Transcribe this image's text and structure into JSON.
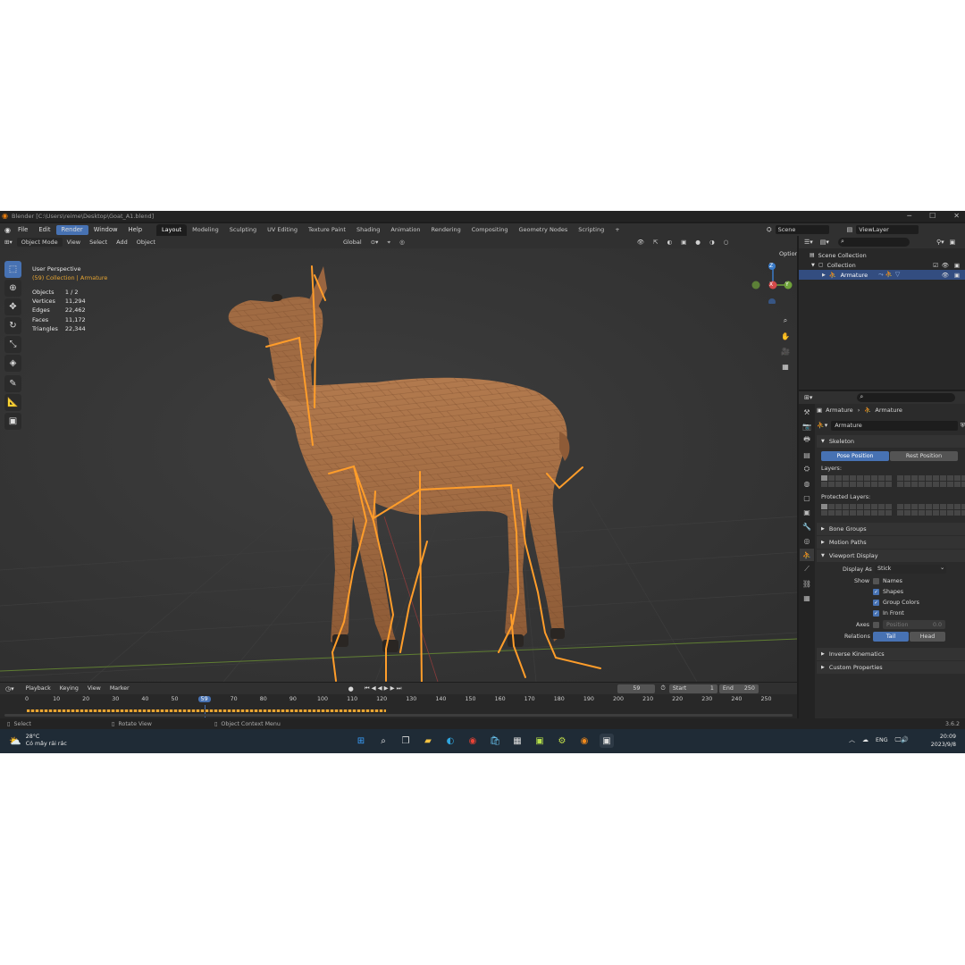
{
  "window": {
    "title": "Blender [C:\\Users\\reime\\Desktop\\Goat_A1.blend]"
  },
  "menu": [
    "File",
    "Edit",
    "Render",
    "Window",
    "Help"
  ],
  "menu_active": "Render",
  "workspaces": [
    "Layout",
    "Modeling",
    "Sculpting",
    "UV Editing",
    "Texture Paint",
    "Shading",
    "Animation",
    "Rendering",
    "Compositing",
    "Geometry Nodes",
    "Scripting"
  ],
  "workspace_add": "+",
  "scene": {
    "name": "Scene",
    "view_layer": "ViewLayer"
  },
  "viewport_header": {
    "mode": "Object Mode",
    "menus": [
      "View",
      "Select",
      "Add",
      "Object"
    ],
    "orientation": "Global",
    "options": "Options"
  },
  "viewport": {
    "perspective": "User Perspective",
    "collection": "(59) Collection | Armature",
    "stats": [
      {
        "label": "Objects",
        "value": "1 / 2"
      },
      {
        "label": "Vertices",
        "value": "11,294"
      },
      {
        "label": "Edges",
        "value": "22,462"
      },
      {
        "label": "Faces",
        "value": "11,172"
      },
      {
        "label": "Triangles",
        "value": "22,344"
      }
    ],
    "gizmo": {
      "x": "X",
      "y": "Y",
      "z": "Z"
    }
  },
  "outliner": {
    "items": [
      {
        "label": "Scene Collection"
      },
      {
        "label": "Collection"
      },
      {
        "label": "Armature"
      }
    ]
  },
  "properties": {
    "breadcrumb": [
      "Armature",
      "Armature"
    ],
    "data_name": "Armature",
    "skeleton": {
      "title": "Skeleton",
      "pose_position": "Pose Position",
      "rest_position": "Rest Position",
      "layers": "Layers:",
      "protected_layers": "Protected Layers:"
    },
    "bone_groups": "Bone Groups",
    "motion_paths": "Motion Paths",
    "viewport_display": {
      "title": "Viewport Display",
      "display_as_label": "Display As",
      "display_as_value": "Stick",
      "show_label": "Show",
      "names": "Names",
      "shapes": "Shapes",
      "group_colors": "Group Colors",
      "in_front": "In Front",
      "axes_label": "Axes",
      "position_label": "Position",
      "position_value": "0.0",
      "relations_label": "Relations",
      "tail": "Tail",
      "head": "Head"
    },
    "inverse_kinematics": "Inverse Kinematics",
    "custom_properties": "Custom Properties"
  },
  "timeline": {
    "menus": [
      "Playback",
      "Keying",
      "View",
      "Marker"
    ],
    "current_frame": "59",
    "start_label": "Start",
    "start": "1",
    "end_label": "End",
    "end": "250",
    "ticks": [
      "0",
      "10",
      "20",
      "30",
      "40",
      "50",
      "59",
      "70",
      "80",
      "90",
      "100",
      "110",
      "120",
      "130",
      "140",
      "150",
      "160",
      "170",
      "180",
      "190",
      "200",
      "210",
      "220",
      "230",
      "240",
      "250"
    ]
  },
  "statusbar": {
    "select": "Select",
    "rotate": "Rotate View",
    "context": "Object Context Menu",
    "version": "3.6.2"
  },
  "taskbar": {
    "weather_temp": "28°C",
    "weather_desc": "Có mây rải rác",
    "lang": "ENG",
    "time": "20:09",
    "date": "2023/9/8"
  },
  "colors": {
    "accent": "#4772b3",
    "bone": "#ff9d2a",
    "goat_body": "#a6714a"
  }
}
